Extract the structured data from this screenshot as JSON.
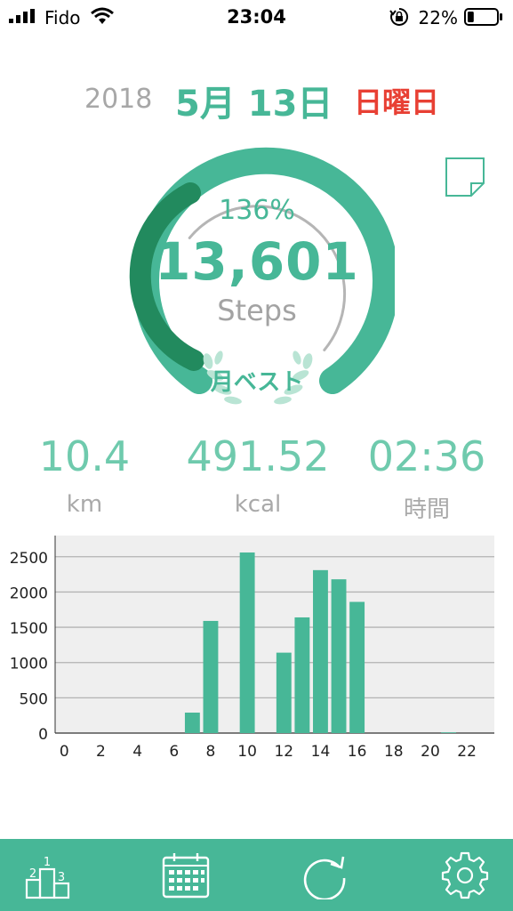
{
  "status_bar": {
    "carrier": "Fido",
    "time": "23:04",
    "battery_percent": "22%",
    "battery_level": 0.22
  },
  "date": {
    "year": "2018",
    "month_day": "5月 13日",
    "weekday": "日曜日"
  },
  "goal": {
    "percent_label": "136%",
    "steps_value": "13,601",
    "steps_unit": "Steps",
    "badge": "月ベスト"
  },
  "metrics": [
    {
      "value": "10.4",
      "unit": "km"
    },
    {
      "value": "491.52",
      "unit": "kcal"
    },
    {
      "value": "02:36",
      "unit": "時間"
    }
  ],
  "colors": {
    "accent": "#47b797",
    "accent_dark": "#228a5e",
    "accent_light": "#6fcaad",
    "weekday_red": "#e84034",
    "gray": "#a7a7a7",
    "chart_bg": "#efefef"
  },
  "chart_data": {
    "type": "bar",
    "x": [
      0,
      1,
      2,
      3,
      4,
      5,
      6,
      7,
      8,
      9,
      10,
      11,
      12,
      13,
      14,
      15,
      16,
      17,
      18,
      19,
      20,
      21,
      22,
      23
    ],
    "values": [
      0,
      0,
      0,
      0,
      0,
      0,
      0,
      290,
      1590,
      0,
      2560,
      0,
      1140,
      1640,
      2310,
      2180,
      1860,
      0,
      0,
      0,
      0,
      10,
      0,
      0
    ],
    "x_tick_labels": [
      "0",
      "2",
      "4",
      "6",
      "8",
      "10",
      "12",
      "14",
      "16",
      "18",
      "20",
      "22"
    ],
    "x_ticks": [
      0,
      2,
      4,
      6,
      8,
      10,
      12,
      14,
      16,
      18,
      20,
      22
    ],
    "y_tick_labels": [
      "0",
      "500",
      "1000",
      "1500",
      "2000",
      "2500"
    ],
    "y_ticks": [
      0,
      500,
      1000,
      1500,
      2000,
      2500
    ],
    "ylim": [
      0,
      2800
    ],
    "xlim": [
      -0.5,
      23.5
    ],
    "grid": true
  },
  "tabbar": {
    "items": [
      {
        "icon": "ranking-podium-icon"
      },
      {
        "icon": "calendar-icon"
      },
      {
        "icon": "refresh-icon"
      },
      {
        "icon": "gear-icon"
      }
    ]
  }
}
